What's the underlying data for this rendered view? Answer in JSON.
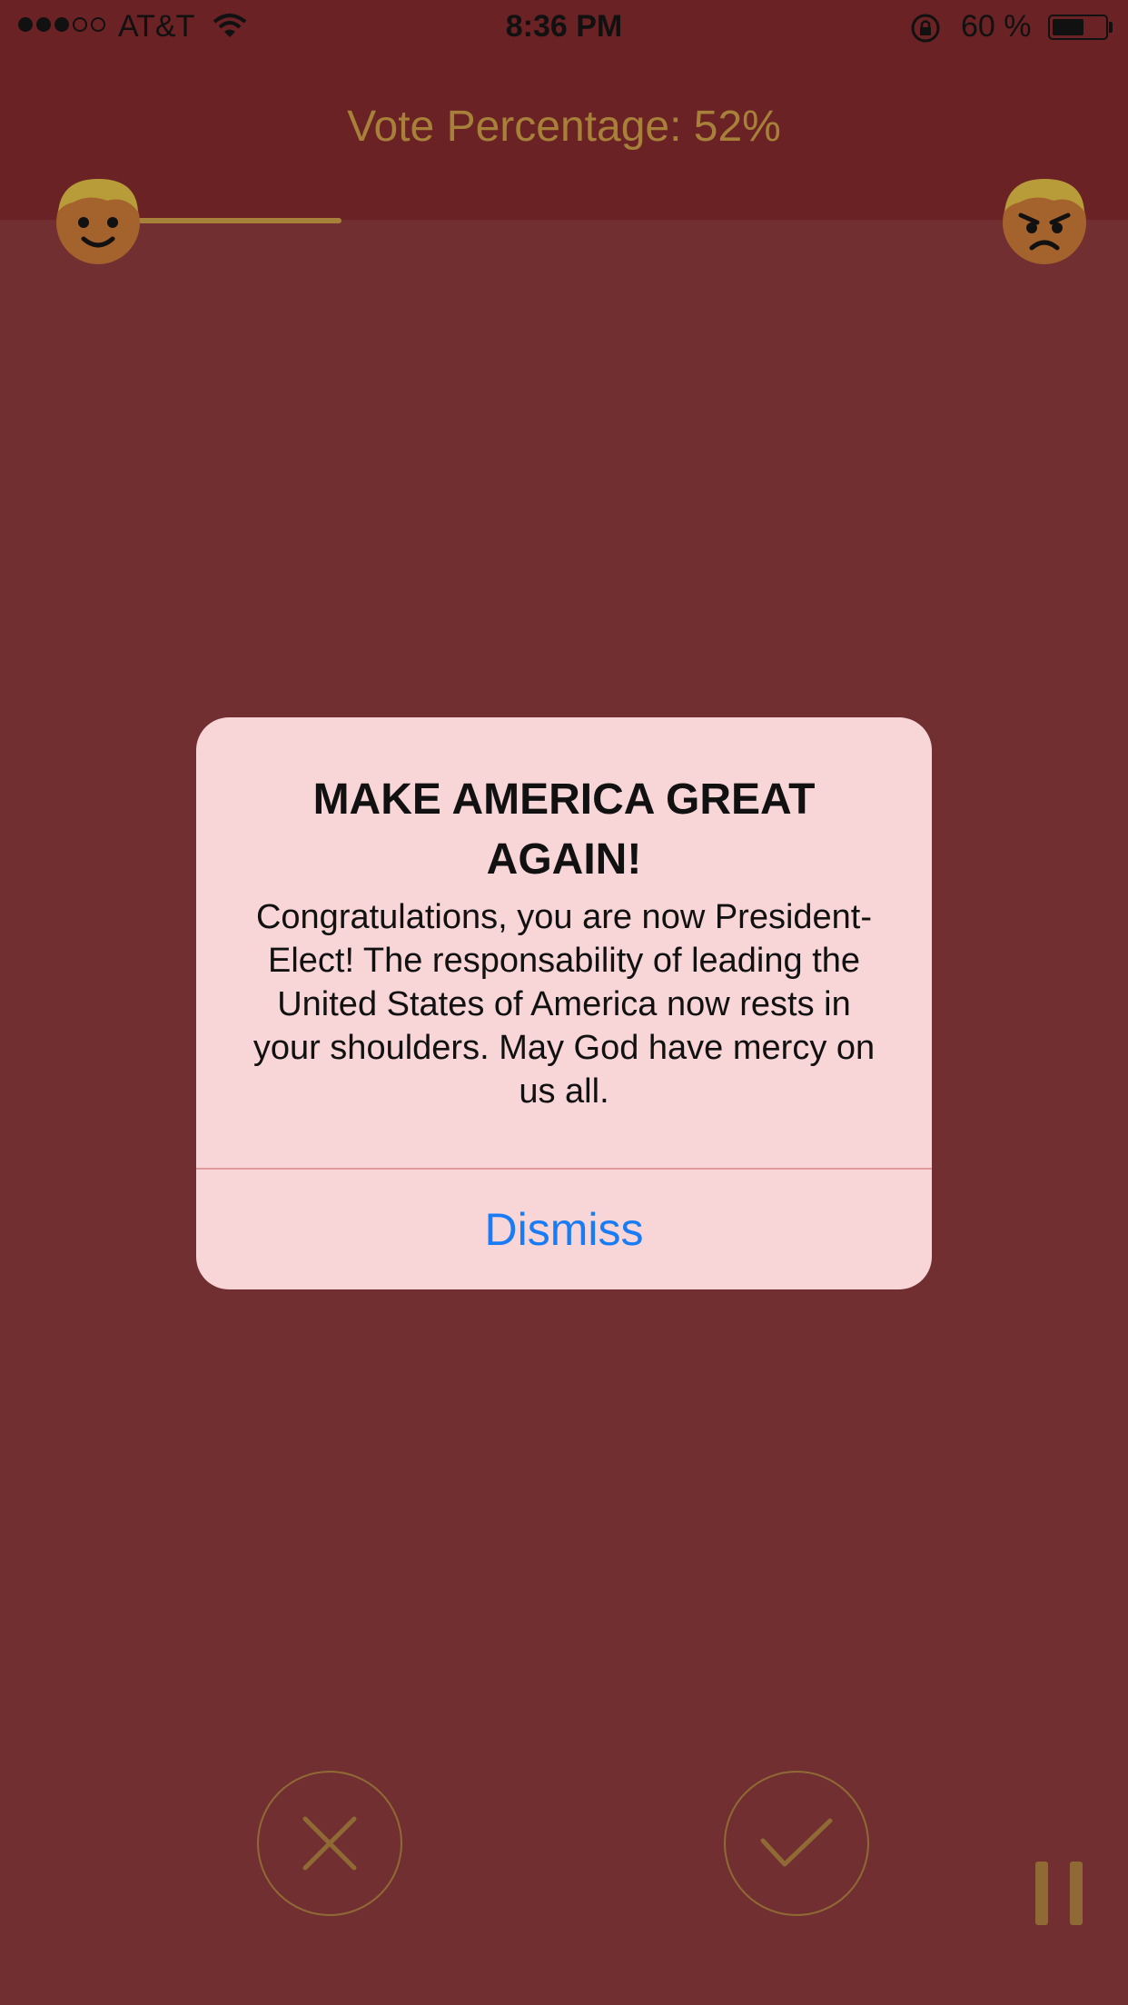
{
  "status_bar": {
    "carrier": "AT&T",
    "time": "8:36 PM",
    "battery_percent_text": "60 %",
    "battery_level": 0.6,
    "signal_bars_filled": 3,
    "signal_bars_total": 5
  },
  "vote": {
    "label": "Vote Percentage: 52%",
    "progress_fraction": 0.52
  },
  "alert": {
    "title": "MAKE AMERICA GREAT AGAIN!",
    "message": "Congratulations, you are now President-Elect! The responsability of leading the United States of America now rests in your shoulders. May God have mercy on us all.",
    "dismiss_label": "Dismiss"
  },
  "icons": {
    "left_face": "happy-face-icon",
    "right_face": "angry-face-icon",
    "reject": "x-icon",
    "accept": "checkmark-icon",
    "pause": "pause-icon"
  },
  "colors": {
    "background": "#712f31",
    "header": "#6a2224",
    "accent_gold": "#a7803a",
    "alert_bg": "#f8d5d6",
    "link_blue": "#1a7cf5"
  }
}
